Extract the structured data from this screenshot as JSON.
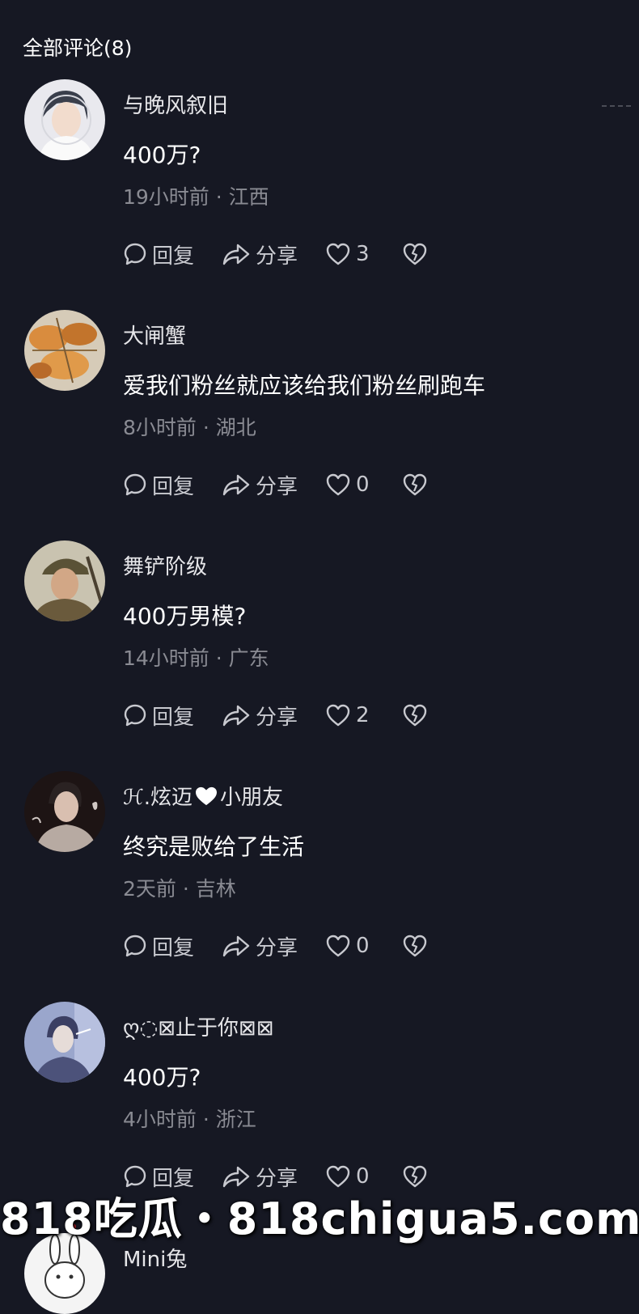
{
  "header": {
    "title": "全部评论(8)"
  },
  "comments": [
    {
      "username": "与晚风叙旧",
      "text": "400万?",
      "meta": "19小时前 · 江西",
      "reply_label": "回复",
      "share_label": "分享",
      "like_count": "3"
    },
    {
      "username": "大闸蟹",
      "text": "爱我们粉丝就应该给我们粉丝刷跑车",
      "meta": "8小时前 · 湖北",
      "reply_label": "回复",
      "share_label": "分享",
      "like_count": "0"
    },
    {
      "username": "舞铲阶级",
      "text": "400万男模?",
      "meta": "14小时前 · 广东",
      "reply_label": "回复",
      "share_label": "分享",
      "like_count": "2"
    },
    {
      "username_part1": "ℋ.炫迈",
      "username_part2": "小朋友",
      "text": "终究是败给了生活",
      "meta": "2天前 · 吉林",
      "reply_label": "回复",
      "share_label": "分享",
      "like_count": "0"
    },
    {
      "username": "ღ◌⊠止于你⊠⊠",
      "text": "400万?",
      "meta": "4小时前 · 浙江",
      "reply_label": "回复",
      "share_label": "分享",
      "like_count": "0"
    },
    {
      "username": "Mini兔"
    }
  ],
  "watermark": {
    "text": "818吃瓜・818chigua5.com"
  },
  "colors": {
    "background": "#161823",
    "meta_text": "#8a8b93",
    "action_text": "#c8c9cf",
    "watermark_dot": "#e0242f"
  }
}
